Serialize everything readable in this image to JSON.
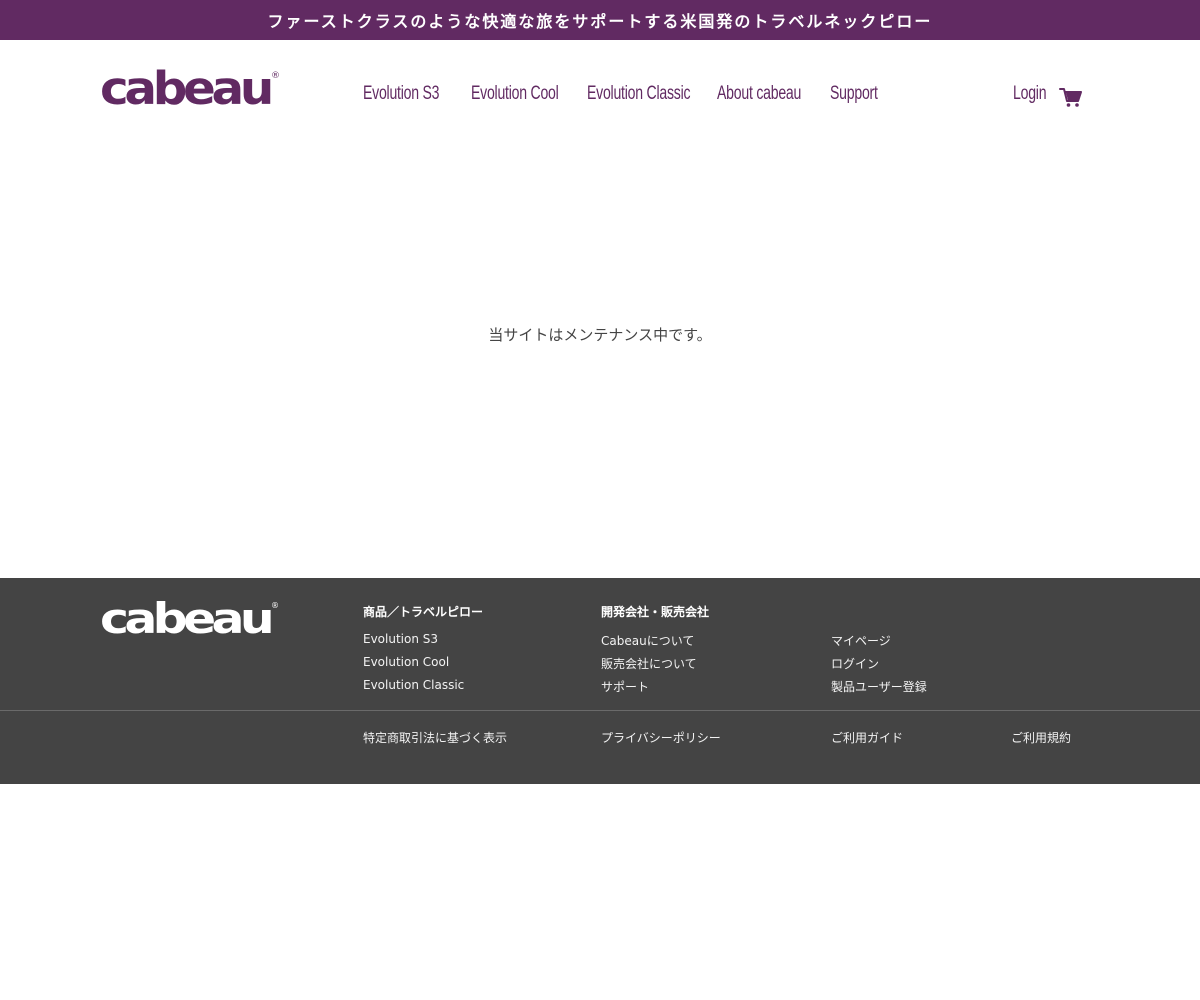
{
  "promo": {
    "text": "ファーストクラスのような快適な旅をサポートする米国発のトラベルネックピロー"
  },
  "brand": {
    "logo_text": "cabeau",
    "registered_mark": "®",
    "primary_color": "#612a62",
    "footer_color": "#444444"
  },
  "nav": {
    "items": [
      {
        "label": "Evolution S3"
      },
      {
        "label": "Evolution Cool"
      },
      {
        "label": "Evolution Classic"
      },
      {
        "label": "About cabeau"
      },
      {
        "label": "Support"
      }
    ],
    "login_label": "Login",
    "cart_icon": "cart-icon"
  },
  "main": {
    "message": "当サイトはメンテナンス中です。"
  },
  "footer": {
    "products_heading": "商品／トラベルピロー",
    "products": [
      {
        "label": "Evolution S3"
      },
      {
        "label": "Evolution Cool"
      },
      {
        "label": "Evolution Classic"
      }
    ],
    "company_heading": "開発会社・販売会社",
    "company": [
      {
        "label": "Cabeauについて"
      },
      {
        "label": "販売会社について"
      },
      {
        "label": "サポート"
      }
    ],
    "account": [
      {
        "label": "マイページ"
      },
      {
        "label": "ログイン"
      },
      {
        "label": "製品ユーザー登録"
      }
    ],
    "legal": [
      {
        "label": "特定商取引法に基づく表示"
      },
      {
        "label": "プライバシーポリシー"
      },
      {
        "label": "ご利用ガイド"
      },
      {
        "label": "ご利用規約"
      }
    ]
  }
}
